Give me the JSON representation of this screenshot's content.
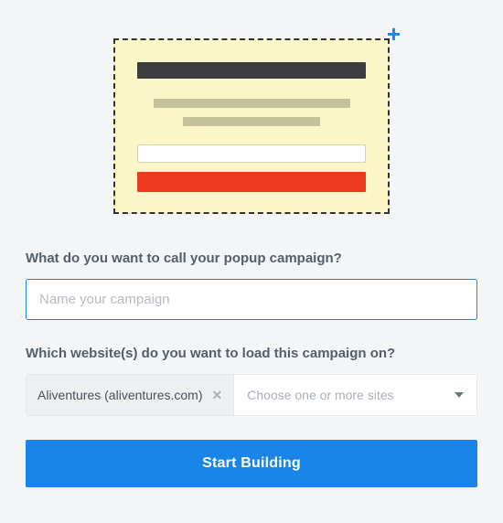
{
  "preview": {
    "plus_icon": "+"
  },
  "form": {
    "name_label": "What do you want to call your popup campaign?",
    "name_placeholder": "Name your campaign",
    "name_value": "",
    "site_label": "Which website(s) do you want to load this campaign on?",
    "selected_site": "Aliventures (aliventures.com)",
    "site_select_placeholder": "Choose one or more sites",
    "submit_label": "Start Building"
  },
  "colors": {
    "accent": "#1a85e8",
    "danger": "#ed3b1f",
    "preview_bg": "#faf6c8"
  }
}
